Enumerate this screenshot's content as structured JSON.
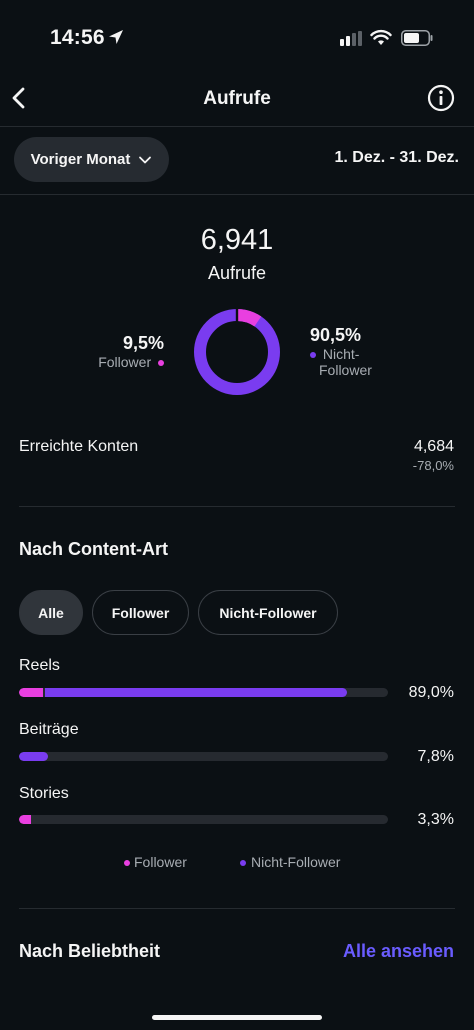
{
  "status_bar": {
    "time": "14:56"
  },
  "header": {
    "title": "Aufrufe"
  },
  "filter": {
    "range_label": "Voriger Monat",
    "date_range": "1. Dez. - 31. Dez."
  },
  "overview": {
    "total": "6,941",
    "total_label": "Aufrufe",
    "follower_pct": "9,5%",
    "follower_label": "Follower",
    "nonfollower_pct": "90,5%",
    "nonfollower_label_line1": "Nicht-",
    "nonfollower_label_line2": "Follower",
    "donut": {
      "follower_fraction": 0.095,
      "nonfollower_fraction": 0.905
    }
  },
  "reached": {
    "label": "Erreichte Konten",
    "value": "4,684",
    "change": "-78,0%"
  },
  "content_type": {
    "title": "Nach Content-Art",
    "chips": [
      "Alle",
      "Follower",
      "Nicht-Follower"
    ],
    "active_chip": "Alle",
    "rows": [
      {
        "label": "Reels",
        "value": "89,0%",
        "total": 0.89,
        "follower": 0.065
      },
      {
        "label": "Beiträge",
        "value": "7,8%",
        "total": 0.078,
        "follower": 0.0
      },
      {
        "label": "Stories",
        "value": "3,3%",
        "total": 0.033,
        "follower": 0.033
      }
    ],
    "legend_follower": "Follower",
    "legend_nonfollower": "Nicht-Follower"
  },
  "popularity": {
    "title": "Nach Beliebtheit",
    "see_all": "Alle ansehen"
  },
  "colors": {
    "background": "#0b1014",
    "follower": "#e93fe0",
    "nonfollower": "#7a3cf0",
    "link": "#6a5cff"
  }
}
